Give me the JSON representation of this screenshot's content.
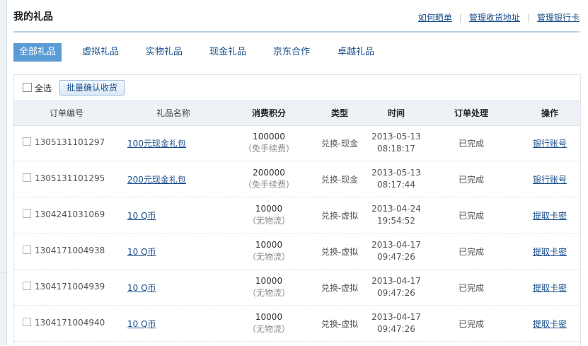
{
  "header": {
    "title": "我的礼品",
    "links": [
      "如何晒单",
      "管理收货地址",
      "管理银行卡"
    ]
  },
  "tabs": [
    "全部礼品",
    "虚拟礼品",
    "实物礼品",
    "现金礼品",
    "京东合作",
    "卓越礼品"
  ],
  "toolbar": {
    "select_all_label": "全选",
    "batch_confirm_label": "批量确认收货"
  },
  "table": {
    "columns": [
      "订单编号",
      "礼品名称",
      "消费积分",
      "类型",
      "时间",
      "订单处理",
      "操作"
    ],
    "rows": [
      {
        "order_no": "1305131101297",
        "gift": "100元现金礼包",
        "points": "100000",
        "note": "（免手续费）",
        "type": "兑换-现金",
        "date": "2013-05-13",
        "time": "08:18:17",
        "status": "已完成",
        "action": "银行账号"
      },
      {
        "order_no": "1305131101295",
        "gift": "200元现金礼包",
        "points": "200000",
        "note": "（免手续费）",
        "type": "兑换-现金",
        "date": "2013-05-13",
        "time": "08:17:44",
        "status": "已完成",
        "action": "银行账号"
      },
      {
        "order_no": "1304241031069",
        "gift": "10 Q币",
        "points": "10000",
        "note": "（无物流）",
        "type": "兑换-虚拟",
        "date": "2013-04-24",
        "time": "19:54:52",
        "status": "已完成",
        "action": "提取卡密"
      },
      {
        "order_no": "1304171004938",
        "gift": "10 Q币",
        "points": "10000",
        "note": "（无物流）",
        "type": "兑换-虚拟",
        "date": "2013-04-17",
        "time": "09:47:26",
        "status": "已完成",
        "action": "提取卡密"
      },
      {
        "order_no": "1304171004939",
        "gift": "10 Q币",
        "points": "10000",
        "note": "（无物流）",
        "type": "兑换-虚拟",
        "date": "2013-04-17",
        "time": "09:47:26",
        "status": "已完成",
        "action": "提取卡密"
      },
      {
        "order_no": "1304171004940",
        "gift": "10 Q币",
        "points": "10000",
        "note": "（无物流）",
        "type": "兑换-虚拟",
        "date": "2013-04-17",
        "time": "09:47:26",
        "status": "已完成",
        "action": "提取卡密"
      }
    ]
  },
  "colors": {
    "accent": "#5b9bd5",
    "link": "#1a4f8b",
    "header_bg": "#eef2f7"
  }
}
